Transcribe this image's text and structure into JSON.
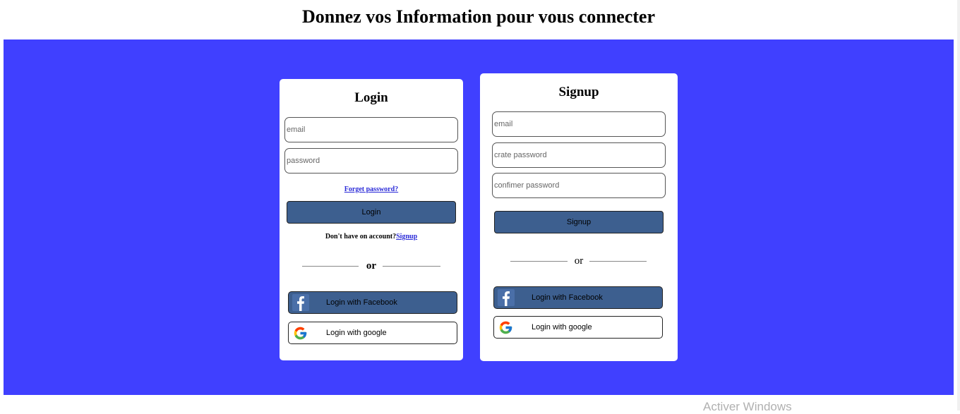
{
  "page": {
    "title": "Donnez vos Information pour vous connecter"
  },
  "colors": {
    "band": "#4040ff",
    "card": "#ffffff",
    "primary_button": "#3d5f8f",
    "link": "#2a2ad8"
  },
  "login": {
    "title": "Login",
    "email_placeholder": "email",
    "password_placeholder": "password",
    "forgot_link": "Forget password?",
    "button_label": "Login",
    "account_prompt": "Don't have on account?",
    "signup_link": "Signup",
    "or_text": "or",
    "facebook_label": "Login with Facebook",
    "google_label": "Login with google",
    "facebook_icon": "facebook-icon",
    "google_icon": "google-icon"
  },
  "signup": {
    "title": "Signup",
    "email_placeholder": "email",
    "password_placeholder": "crate password",
    "confirm_placeholder": "confimer password",
    "button_label": "Signup",
    "or_text": "or",
    "facebook_label": "Login with Facebook",
    "google_label": "Login with google",
    "facebook_icon": "facebook-icon",
    "google_icon": "google-icon"
  },
  "watermark": {
    "text": "Activer Windows"
  }
}
